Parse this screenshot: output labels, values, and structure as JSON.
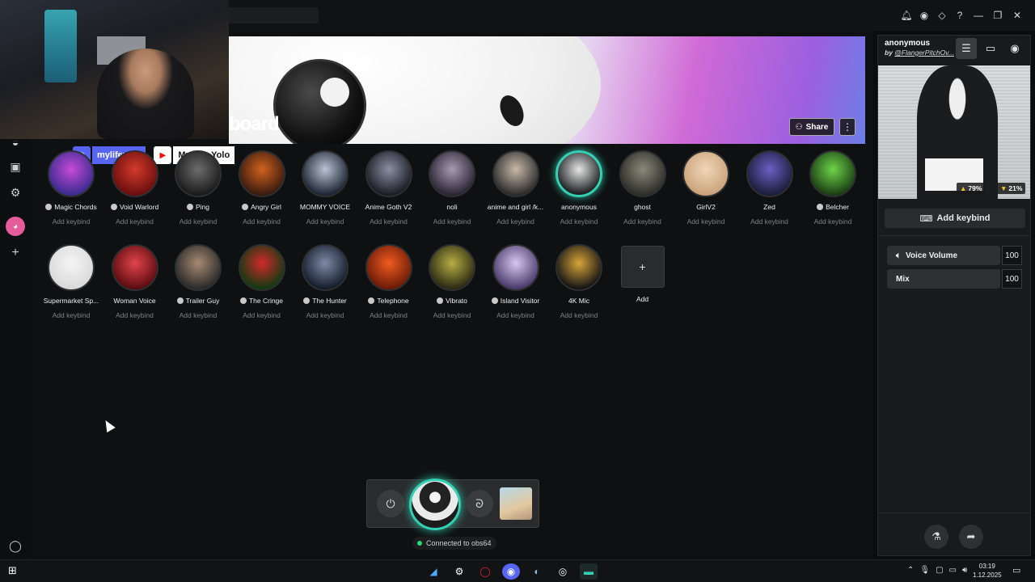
{
  "banner": {
    "title": "board",
    "share_label": "Share",
    "more_label": "⋮"
  },
  "stream_tags": [
    {
      "platform": "discord",
      "name": "mylifeyolo",
      "color": "#5865f2"
    },
    {
      "platform": "youtube",
      "name": "My Life Yolo",
      "color": "#ff0000"
    }
  ],
  "voices": [
    {
      "name": "Magic Chords",
      "keybind": "Add keybind",
      "dot": true,
      "colors": [
        "#3b2a8f",
        "#c54bd8"
      ]
    },
    {
      "name": "Void Warlord",
      "keybind": "Add keybind",
      "dot": true,
      "colors": [
        "#6a0e0e",
        "#d33a2c"
      ]
    },
    {
      "name": "Ping",
      "keybind": "Add keybind",
      "dot": true,
      "colors": [
        "#1a1a1a",
        "#6d6d6d"
      ]
    },
    {
      "name": "Angry Girl",
      "keybind": "Add keybind",
      "dot": true,
      "colors": [
        "#3a1a10",
        "#d0621e"
      ]
    },
    {
      "name": "MOMMY VOICE",
      "keybind": "Add keybind",
      "dot": false,
      "colors": [
        "#1c2433",
        "#b9c3d3"
      ]
    },
    {
      "name": "Anime Goth V2",
      "keybind": "Add keybind",
      "dot": false,
      "colors": [
        "#1a1c24",
        "#8a8fa3"
      ]
    },
    {
      "name": "noli",
      "keybind": "Add keybind",
      "dot": false,
      "colors": [
        "#2a2433",
        "#a79ab3"
      ]
    },
    {
      "name": "anime and girl /k...",
      "keybind": "Add keybind",
      "dot": false,
      "colors": [
        "#2b2b2b",
        "#c9b9a9"
      ]
    },
    {
      "name": "anonymous",
      "keybind": "Add keybind",
      "dot": false,
      "active": true,
      "colors": [
        "#1b1c1e",
        "#e6e6e6"
      ]
    },
    {
      "name": "ghost",
      "keybind": "Add keybind",
      "dot": false,
      "colors": [
        "#2d2d28",
        "#8a8a7a"
      ]
    },
    {
      "name": "GirlV2",
      "keybind": "Add keybind",
      "dot": false,
      "colors": [
        "#c9a27a",
        "#f0d6b8"
      ]
    },
    {
      "name": "Zed",
      "keybind": "Add keybind",
      "dot": false,
      "colors": [
        "#1a1d3a",
        "#6b5fc4"
      ]
    },
    {
      "name": "Belcher",
      "keybind": "Add keybind",
      "dot": true,
      "colors": [
        "#1a3d14",
        "#6ed44a"
      ]
    },
    {
      "name": "Supermarket Sp...",
      "keybind": "Add keybind",
      "dot": false,
      "colors": [
        "#d9d9d9",
        "#f5f5f5"
      ]
    },
    {
      "name": "Woman Voice",
      "keybind": "Add keybind",
      "dot": false,
      "colors": [
        "#5a0c10",
        "#e2434b"
      ]
    },
    {
      "name": "Trailer Guy",
      "keybind": "Add keybind",
      "dot": true,
      "colors": [
        "#2a2a2a",
        "#a78a72"
      ]
    },
    {
      "name": "The Cringe",
      "keybind": "Add keybind",
      "dot": true,
      "colors": [
        "#0f3a12",
        "#d02a2a"
      ]
    },
    {
      "name": "The Hunter",
      "keybind": "Add keybind",
      "dot": true,
      "colors": [
        "#141c2a",
        "#7e8aa6"
      ]
    },
    {
      "name": "Telephone",
      "keybind": "Add keybind",
      "dot": true,
      "colors": [
        "#6b1a08",
        "#f05b1f"
      ]
    },
    {
      "name": "Vibrato",
      "keybind": "Add keybind",
      "dot": true,
      "colors": [
        "#2b2a14",
        "#b7ad43"
      ]
    },
    {
      "name": "Island Visitor",
      "keybind": "Add keybind",
      "dot": true,
      "colors": [
        "#4a3a6a",
        "#d7c6f0"
      ]
    },
    {
      "name": "4K Mic",
      "keybind": "Add keybind",
      "dot": false,
      "colors": [
        "#141414",
        "#d8a43a"
      ]
    }
  ],
  "add_tile": {
    "icon": "+",
    "label": "Add"
  },
  "status": {
    "text": "Connected to obs64"
  },
  "right_panel": {
    "voice_name": "anonymous",
    "author_prefix": "by",
    "author": "@FlangerPitchOv...",
    "like_pct": "79%",
    "dislike_pct": "21%",
    "keybind_label": "Add keybind",
    "voice_volume_label": "Voice Volume",
    "voice_volume_value": "100",
    "mix_label": "Mix",
    "mix_value": "100"
  },
  "taskbar": {
    "time": "03:19",
    "date": "1.12.2025"
  }
}
